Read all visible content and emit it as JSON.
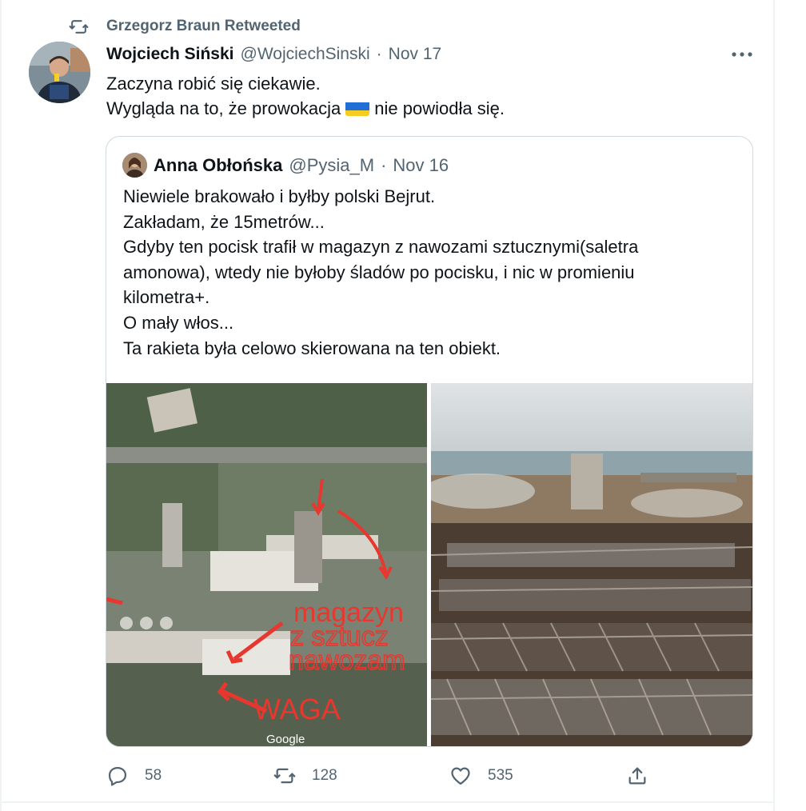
{
  "retweet": {
    "label": "Grzegorz Braun Retweeted"
  },
  "tweet": {
    "author_name": "Wojciech Siński",
    "handle": "@WojciechSinski",
    "date": "Nov 17",
    "separator": "·",
    "line1": "Zaczyna robić się ciekawie.",
    "line2_before": "Wygląda na to, że prowokacja",
    "line2_after": "nie powiodła się.",
    "flag_colors": [
      "#1f6fd6",
      "#f5cc22"
    ]
  },
  "quote": {
    "author_name": "Anna Obłońska",
    "handle": "@Pysia_M",
    "date": "Nov 16",
    "separator": "·",
    "lines": [
      "Niewiele brakowało i byłby polski Bejrut.",
      "Zakładam, że 15metrów...",
      "Gdyby ten pocisk trafił w magazyn z nawozami sztucznymi(saletra",
      "amonowa), wtedy nie byłoby śladów po pocisku, i nic w promieniu",
      "kilometra+.",
      "O mały włos...",
      "Ta rakieta była celowo skierowana na ten obiekt."
    ],
    "media": {
      "left_labels": [
        "magazyn",
        "z sztucz",
        "nawozam",
        "WAGA"
      ],
      "watermark": "Google",
      "annotation_color": "#e8372e"
    }
  },
  "actions": {
    "reply_count": "58",
    "retweet_count": "128",
    "like_count": "535"
  },
  "icons": {
    "retweet": "retweet-icon",
    "more": "more-icon",
    "reply": "reply-icon",
    "like": "heart-icon",
    "share": "share-icon"
  },
  "colors": {
    "text_primary": "#0f1419",
    "text_secondary": "#536471",
    "border": "#cfd9de"
  }
}
